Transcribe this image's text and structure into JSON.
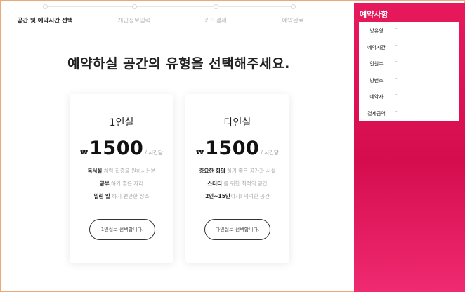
{
  "steps": [
    {
      "label": "공간 및 예약시간 선택",
      "active": true
    },
    {
      "label": "개인정보입력",
      "active": false
    },
    {
      "label": "카드결제",
      "active": false
    },
    {
      "label": "예약완료",
      "active": false
    }
  ],
  "headline": "예약하실 공간의 유형을 선택해주세요.",
  "cards": [
    {
      "title": "1인실",
      "currency": "₩",
      "price": "1500",
      "unit": "/ 시간당",
      "features": [
        {
          "bold": "독서실",
          "rest": " 처럼 집중을 원하시는분"
        },
        {
          "bold": "공부",
          "rest": " 하기 좋은 자리"
        },
        {
          "bold": "밀린 일",
          "rest": " 하기 편안한 장소"
        }
      ],
      "button": "1인실로 선택합니다."
    },
    {
      "title": "다인실",
      "currency": "₩",
      "price": "1500",
      "unit": "/ 시간당",
      "features": [
        {
          "bold": "중요한 회의",
          "rest": " 하기 좋은 공간과 시설"
        },
        {
          "bold": "스터디",
          "rest": " 를 위한 최적의 공간"
        },
        {
          "bold": "2인~15인",
          "rest": "까지! 넉넉한 공간"
        }
      ],
      "button": "다인실로 선택합니다."
    }
  ],
  "sidebar": {
    "title": "예약사항",
    "rows": [
      {
        "label": "방유형",
        "value": "-"
      },
      {
        "label": "예약시간",
        "value": "-"
      },
      {
        "label": "인원수",
        "value": "-"
      },
      {
        "label": "방번호",
        "value": "-"
      },
      {
        "label": "예약자",
        "value": "-"
      },
      {
        "label": "결제금액",
        "value": "-"
      }
    ]
  },
  "colors": {
    "accent": "#e7195c",
    "frame_border": "#e9a978"
  }
}
